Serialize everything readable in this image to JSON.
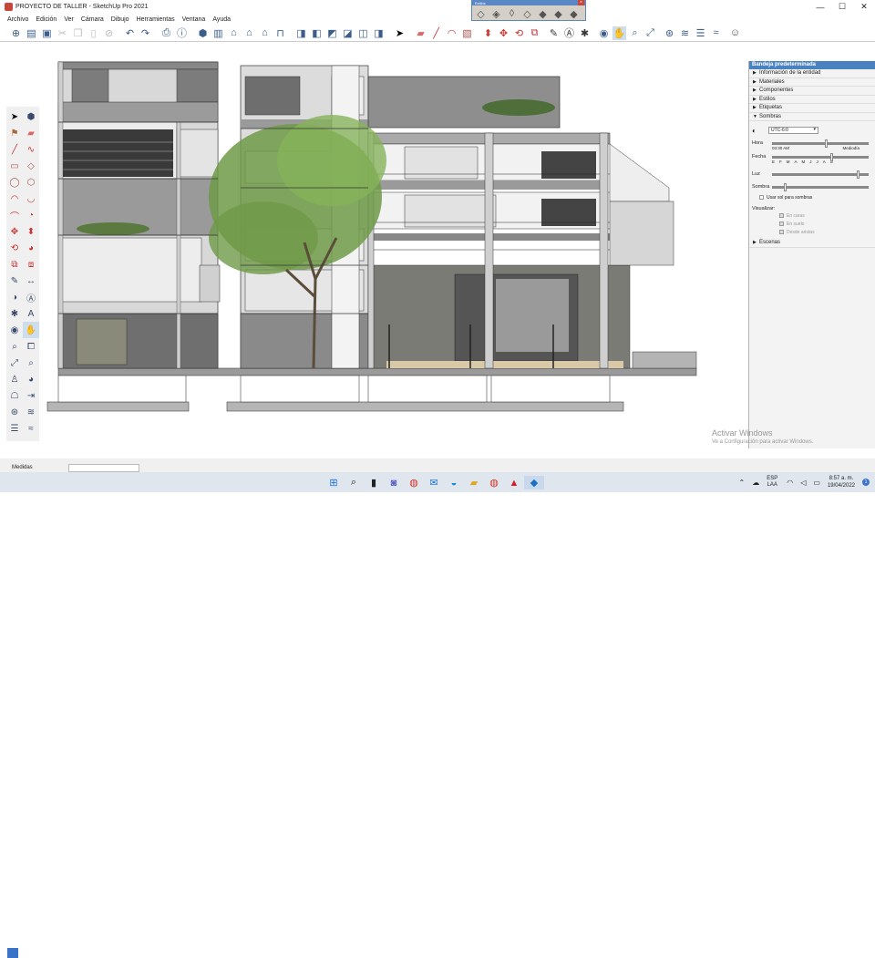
{
  "window": {
    "title": "PROYECTO DE TALLER - SketchUp Pro 2021",
    "controls": [
      "—",
      "☐",
      "✕"
    ]
  },
  "menu": [
    "Archivo",
    "Edición",
    "Ver",
    "Cámara",
    "Dibujo",
    "Herramientas",
    "Ventana",
    "Ayuda"
  ],
  "toolbar_icons": [
    "new-icon",
    "open-icon",
    "save-icon",
    "cut-icon",
    "copy-icon",
    "paste-icon",
    "erase-icon",
    "undo-icon",
    "redo-icon",
    "print-icon",
    "model-info-icon",
    "component-icon",
    "group-icon",
    "home-icon",
    "house-icon",
    "house2-icon",
    "store-icon",
    "views-iso-icon",
    "views-top-icon",
    "views-front-icon",
    "views-right-icon",
    "views-back-icon",
    "views-left-icon",
    "select-icon",
    "eraser-icon",
    "line-icon",
    "arc-icon",
    "paint-icon",
    "push-pull-icon",
    "move-icon",
    "rotate-icon",
    "scale-icon",
    "offset-icon",
    "tape-icon",
    "text-icon",
    "axes-icon",
    "orbit-icon",
    "pan-icon",
    "zoom-icon",
    "zoom-extents-icon",
    "warehouse-icon",
    "extension-icon",
    "layer-icon",
    "sandbox-icon",
    "user-icon"
  ],
  "floating_toolbar": {
    "title": "Estilos",
    "close": "×"
  },
  "tray": {
    "title": "Bandeja predeterminada",
    "sections": [
      {
        "label": "Información de la entidad",
        "arrow": "▶"
      },
      {
        "label": "Materiales",
        "arrow": "▶"
      },
      {
        "label": "Componentes",
        "arrow": "▶"
      },
      {
        "label": "Estilos",
        "arrow": "▶"
      },
      {
        "label": "Etiquetas",
        "arrow": "▶"
      },
      {
        "label": "Sombras",
        "arrow": "▼"
      }
    ],
    "shadows": {
      "timezone": "UTC-6:0",
      "hora_label": "Hora",
      "hora_value": "03:30 AM",
      "hora_right": "Mediodía",
      "fecha_label": "Fecha",
      "months": [
        "E",
        "F",
        "M",
        "A",
        "M",
        "J",
        "J",
        "A",
        "S"
      ],
      "luz_label": "Luz",
      "sombra_label": "Sombra",
      "use_sun": "Usar sol para sombras",
      "visualizar_label": "Visualizar:",
      "en_caras": "En caras",
      "en_suelo": "En suelo",
      "desde_aristas": "Desde aristas"
    },
    "escenas": {
      "label": "Escenas",
      "arrow": "▶"
    }
  },
  "status": {
    "label": "Medidas"
  },
  "watermark": {
    "line1": "Activar Windows",
    "line2": "Ve a Configuración para activar Windows."
  },
  "taskbar": {
    "apps": [
      "windows-start-icon",
      "search-icon",
      "file-explorer-icon",
      "teams-icon",
      "chrome-icon",
      "mail-icon",
      "edge-icon",
      "folder-icon",
      "chrome2-icon",
      "acrobat-icon",
      "sketchup-icon"
    ],
    "lang_line1": "ESP",
    "lang_line2": "LAA",
    "time": "8:57 a. m.",
    "date": "19/04/2022",
    "notifications": "1"
  }
}
